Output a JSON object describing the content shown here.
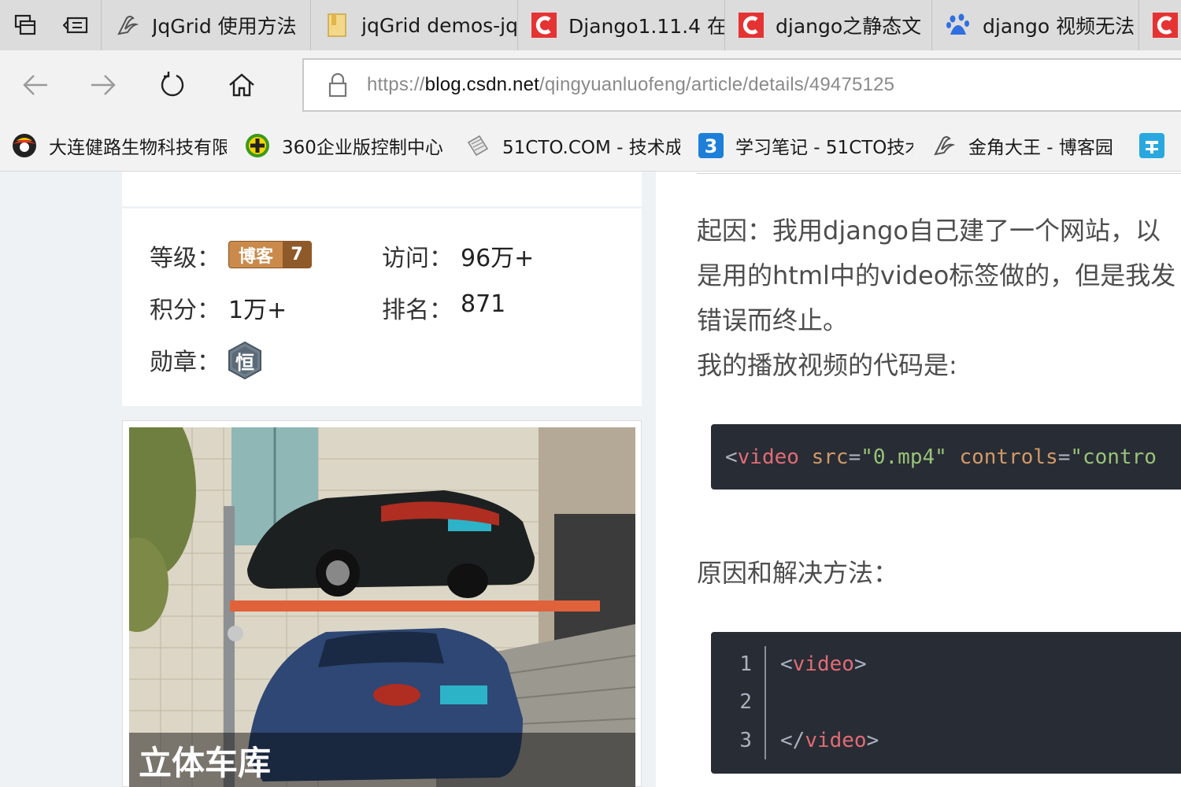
{
  "tabs": [
    {
      "title": "JqGrid 使用方法",
      "icon": "quill-feather-icon"
    },
    {
      "title": "jqGrid demos-jq",
      "icon": "folder-file-icon"
    },
    {
      "title": "Django1.11.4 在",
      "icon": "csdn-logo-icon"
    },
    {
      "title": "django之静态文",
      "icon": "csdn-logo-icon"
    },
    {
      "title": "django 视频无法",
      "icon": "baidu-paw-icon"
    },
    {
      "title": "",
      "icon": "csdn-logo-icon"
    }
  ],
  "address": {
    "scheme": "https://",
    "host": "blog.csdn.net",
    "path": "/qingyuanluofeng/article/details/49475125"
  },
  "bookmarks": [
    {
      "label": "大连健路生物科技有限",
      "icon": "ball-logo-icon"
    },
    {
      "label": "360企业版控制中心",
      "icon": "plus-shield-icon"
    },
    {
      "label": "51CTO.COM - 技术成",
      "icon": "page-curl-icon"
    },
    {
      "label": "学习笔记 - 51CTO技术",
      "icon": "blue-three-icon"
    },
    {
      "label": "金角大王 - 博客园",
      "icon": "quill-feather-icon"
    },
    {
      "label": "",
      "icon": "xue-character-icon"
    }
  ],
  "profile": {
    "level_label": "等级：",
    "level_badge_text": "博客",
    "level_badge_num": "7",
    "visits_label": "访问：",
    "visits_value": "96万+",
    "points_label": "积分：",
    "points_value": "1万+",
    "rank_label": "排名：",
    "rank_value": "871",
    "medal_label": "勋章：",
    "medal_text": "恒"
  },
  "ad": {
    "caption": "立体车库"
  },
  "article": {
    "para1_line1": "起因：我用django自己建了一个网站，以",
    "para1_line2": "是用的html中的video标签做的，但是我发",
    "para1_line3": "错误而终止。",
    "para2": "我的播放视频的代码是:",
    "code1": {
      "open": "<",
      "tag": "video",
      "attr1": "src",
      "eq": "=",
      "val1": "\"0.mp4\"",
      "attr2": "controls",
      "val2": "\"contro"
    },
    "heading": "原因和解决方法：",
    "code2": {
      "line_numbers": [
        "1",
        "2",
        "3"
      ],
      "line1_open": "<",
      "line1_tag": "video",
      "line1_close": ">",
      "line3_open": "</",
      "line3_tag": "video",
      "line3_close": ">"
    }
  },
  "colors": {
    "csdn_red": "#e53333",
    "badge_bronze": "#c98a4b",
    "code_bg": "#282c34",
    "code_tag": "#e06c75",
    "code_attr": "#d19a66",
    "code_string": "#98c379"
  }
}
